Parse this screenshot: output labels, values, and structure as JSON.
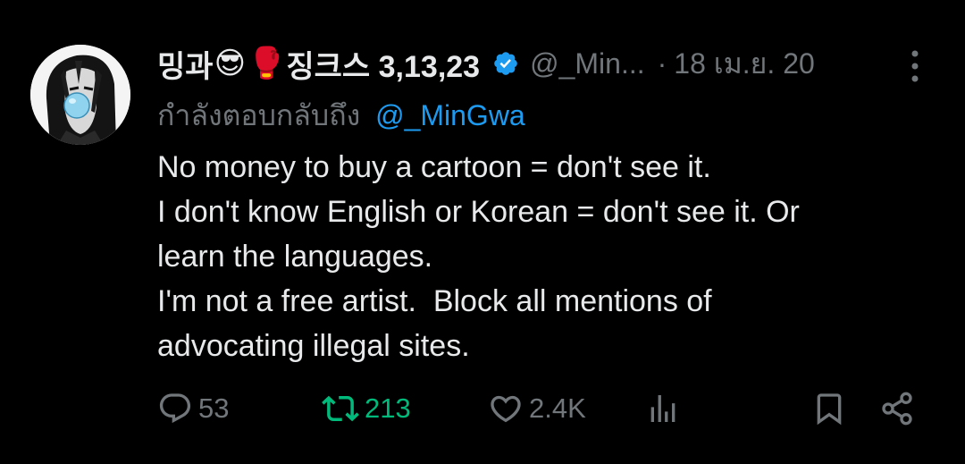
{
  "tweet": {
    "author": {
      "name_prefix": "밍과",
      "emoji_1": "😎",
      "emoji_2": "🥊",
      "name_suffix": "징크스 3,13,23",
      "handle": "@_Min...",
      "verified": true
    },
    "separator": "·",
    "date": "18 เม.ย. 20",
    "replying_to_label": "กำลังตอบกลับถึง",
    "replying_to_handle": "@_MinGwa",
    "text_lines": [
      "No money to buy a cartoon = don't see it.",
      "I don't know English or Korean = don't see it. Or",
      "learn the languages.",
      "I'm not a free artist.  Block all mentions of",
      "advocating illegal sites."
    ],
    "stats": {
      "replies": "53",
      "retweets": "213",
      "likes": "2.4K"
    }
  },
  "colors": {
    "background": "#000000",
    "primary_text": "#e7e9ea",
    "secondary_text": "#71767b",
    "link": "#1d9bf0",
    "retweeted": "#00ba7c"
  },
  "icons": {
    "reply": "speech-bubble-icon",
    "retweet": "retweet-arrows-icon",
    "like": "heart-icon",
    "views": "bar-chart-icon",
    "bookmark": "bookmark-icon",
    "share": "share-icon",
    "more": "vertical-dots-icon",
    "verified": "verified-badge-icon"
  }
}
